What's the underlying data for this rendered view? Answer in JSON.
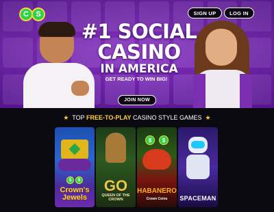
{
  "brand": {
    "logo_left": "C",
    "logo_right": "S"
  },
  "header": {
    "signup_label": "SIGN UP",
    "login_label": "LOG IN"
  },
  "hero": {
    "line1": "#1 SOCIAL",
    "line2": "CASINO",
    "line3": "IN AMERICA",
    "subtitle": "GET READY TO WIN BIG!",
    "cta_label": "JOIN NOW"
  },
  "games_section": {
    "title_prefix": "TOP ",
    "title_highlight": "FREE-TO-PLAY",
    "title_suffix": " CASINO STYLE GAMES",
    "star": "★",
    "games": [
      {
        "name": "Crown's Jewels",
        "line1": "Crown's",
        "line2": "Jewels"
      },
      {
        "name": "GO Queen of the Crown",
        "line1": "GO",
        "line2": "QUEEN OF THE CROWN"
      },
      {
        "name": "Habanero Crown Coins",
        "line1": "HABANERO",
        "line2": "Crown Coins"
      },
      {
        "name": "Spaceman",
        "line1": "SPACEMAN"
      }
    ]
  },
  "colors": {
    "accent": "#ffd23a",
    "hero_purple": "#8b35c4",
    "brand_green": "#2bd24a"
  }
}
